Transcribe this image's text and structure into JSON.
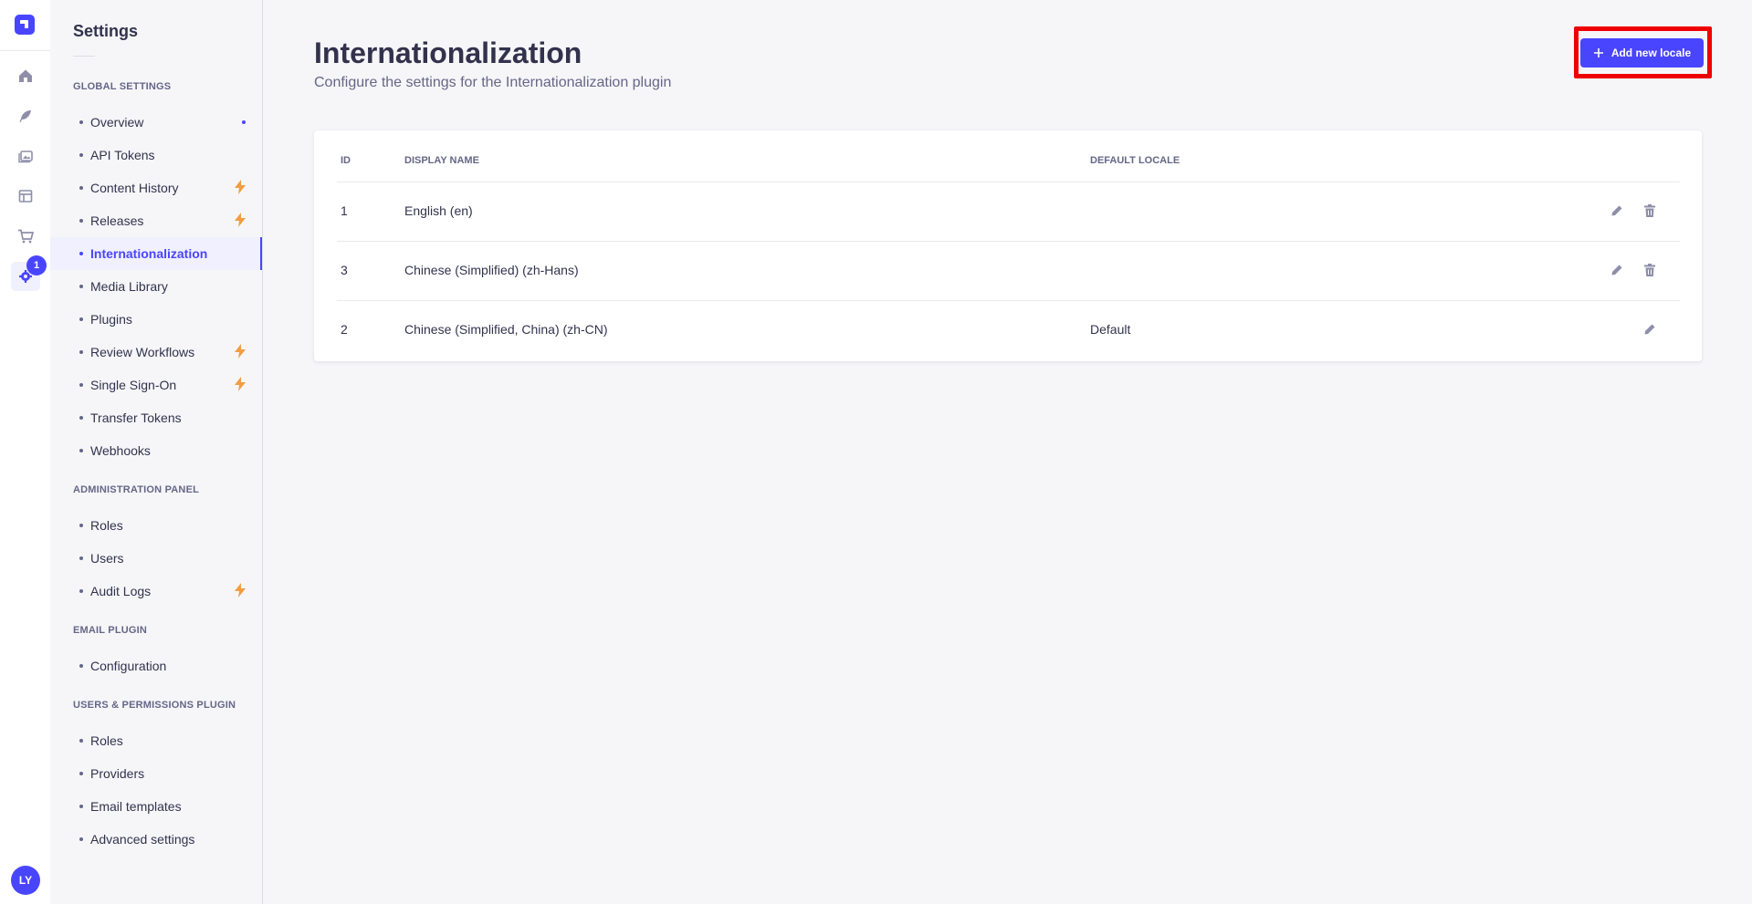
{
  "rail": {
    "notification_count": "1",
    "avatar_initials": "LY",
    "icons": [
      "home-icon",
      "feather-icon",
      "media-icon",
      "layout-icon",
      "cart-icon",
      "settings-icon"
    ]
  },
  "sidebar": {
    "title": "Settings",
    "sections": {
      "global": {
        "label": "GLOBAL SETTINGS",
        "items": [
          "Overview",
          "API Tokens",
          "Content History",
          "Releases",
          "Internationalization",
          "Media Library",
          "Plugins",
          "Review Workflows",
          "Single Sign-On",
          "Transfer Tokens",
          "Webhooks"
        ]
      },
      "admin": {
        "label": "ADMINISTRATION PANEL",
        "items": [
          "Roles",
          "Users",
          "Audit Logs"
        ]
      },
      "email": {
        "label": "EMAIL PLUGIN",
        "items": [
          "Configuration"
        ]
      },
      "users_permissions": {
        "label": "USERS & PERMISSIONS PLUGIN",
        "items": [
          "Roles",
          "Providers",
          "Email templates",
          "Advanced settings"
        ]
      }
    }
  },
  "main": {
    "title": "Internationalization",
    "subtitle": "Configure the settings for the Internationalization plugin",
    "add_button_label": "Add new locale",
    "table": {
      "headers": [
        "ID",
        "DISPLAY NAME",
        "DEFAULT LOCALE"
      ],
      "rows": [
        {
          "id": "1",
          "display_name": "English (en)",
          "default_locale": ""
        },
        {
          "id": "3",
          "display_name": "Chinese (Simplified) (zh-Hans)",
          "default_locale": ""
        },
        {
          "id": "2",
          "display_name": "Chinese (Simplified, China) (zh-CN)",
          "default_locale": "Default"
        }
      ]
    }
  },
  "colors": {
    "accent": "#4945ff",
    "bolt": "#f29d41",
    "highlight": "#ee0000"
  }
}
